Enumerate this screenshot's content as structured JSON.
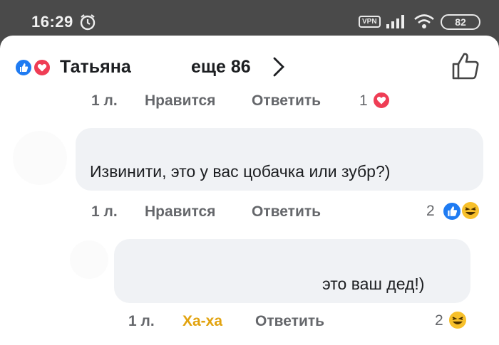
{
  "status_bar": {
    "time": "16:29",
    "vpn": "VPN",
    "battery": "82",
    "icons": [
      "alarm-icon",
      "signal-icon",
      "wifi-icon",
      "battery-icon"
    ]
  },
  "header": {
    "name": "Татьяна",
    "more": "еще 86",
    "reactions": [
      "like-reaction-icon",
      "love-reaction-icon"
    ]
  },
  "comments": [
    {
      "time": "1 л.",
      "like_label": "Нравится",
      "reply_label": "Ответить",
      "reaction_count": "1",
      "reactions": [
        "love-reaction-icon"
      ]
    },
    {
      "text": "Извинити, это у вас цобачка или зубр?)",
      "time": "1 л.",
      "like_label": "Нравится",
      "reply_label": "Ответить",
      "reaction_count": "2",
      "reactions": [
        "like-reaction-icon",
        "haha-reaction-icon"
      ]
    },
    {
      "text": "это ваш дед!)",
      "time": "1 л.",
      "like_label": "Ха-ха",
      "like_label_color": "#e2a30f",
      "reply_label": "Ответить",
      "reaction_count": "2",
      "reactions": [
        "haha-reaction-icon"
      ]
    }
  ],
  "colors": {
    "like_blue": "#1f7bf2",
    "love_red": "#ef3d55",
    "haha_yellow": "#f7c02b",
    "bubble_bg": "#f0f2f5",
    "meta_gray": "#65676b"
  }
}
